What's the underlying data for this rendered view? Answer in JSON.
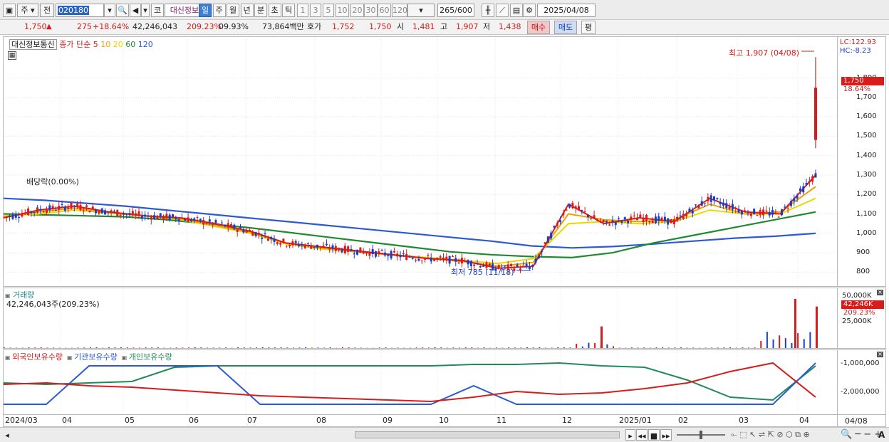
{
  "toolbar": {
    "market": "주",
    "prev": "전",
    "code": "020180",
    "mode": "코",
    "name": "대신정보통",
    "periods": [
      {
        "label": "일",
        "selected": true
      },
      {
        "label": "주"
      },
      {
        "label": "월"
      },
      {
        "label": "년"
      },
      {
        "label": "분"
      },
      {
        "label": "초"
      },
      {
        "label": "틱"
      }
    ],
    "intervals": [
      "1",
      "3",
      "5",
      "10",
      "20",
      "30",
      "60",
      "120"
    ],
    "count": "265",
    "count_total": "/600",
    "date": "2025/04/08"
  },
  "quote": {
    "price": "1,750",
    "change": "275",
    "change_pct": "+18.64%",
    "volume": "42,246,043",
    "vol_ratio": "209.23%",
    "turnover": "09.93%",
    "amount": "73,864백만",
    "hoga_label": "호가",
    "ask": "1,752",
    "bid": "1,750",
    "open_label": "시",
    "open": "1,481",
    "high_label": "고",
    "high": "1,907",
    "low_label": "저",
    "low": "1,438",
    "buy_btn": "매수",
    "sell_btn": "매도",
    "eval_btn": "평"
  },
  "price_panel": {
    "legend_name": "대신정보통신",
    "legend_ma": [
      {
        "label": "종가 단순 5",
        "color": "#d81b1b"
      },
      {
        "label": "10",
        "color": "#f0a000"
      },
      {
        "label": "20",
        "color": "#e8d800"
      },
      {
        "label": "60",
        "color": "#1f8a2f"
      },
      {
        "label": "120",
        "color": "#2c5ad4"
      }
    ],
    "lc": "LC:122.93",
    "hc": "HC:-8.23",
    "y_ticks": [
      "1,800",
      "1,700",
      "1,600",
      "1,500",
      "1,400",
      "1,300",
      "1,200",
      "1,100",
      "1,000",
      "900",
      "800"
    ],
    "current_price_tag": "1,750",
    "current_pct_tag": "18.64%",
    "high_annotation": "최고 1,907 (04/08)",
    "low_annotation": "최저 785 (11/18)",
    "dividend_annotation": "배당락(0.00%)"
  },
  "volume_panel": {
    "title": "거래량",
    "value": "42,246,043주(209.23%)",
    "y_ticks": [
      "50,000K",
      "25,000K"
    ],
    "current_tag": "42,246K",
    "current_pct": "209.23%"
  },
  "holding_panel": {
    "legend": [
      {
        "label": "외국인보유수량",
        "color": "#d81b1b"
      },
      {
        "label": "기관보유수량",
        "color": "#2c5ad4"
      },
      {
        "label": "개인보유수량",
        "color": "#1f8a5a"
      }
    ],
    "y_ticks": [
      "-1,000,000",
      "-2,000,000"
    ]
  },
  "x_axis": [
    "2024/03",
    "04",
    "05",
    "06",
    "07",
    "08",
    "09",
    "10",
    "11",
    "12",
    "2025/01",
    "02",
    "03",
    "04"
  ],
  "x_axis_right": "04/08",
  "colors": {
    "up": "#d81b1b",
    "down": "#1a3fc4",
    "ma5": "#d81b1b",
    "ma10": "#f0a000",
    "ma20": "#e8d800",
    "ma60": "#1f8a2f",
    "ma120": "#2c5ad4"
  },
  "chart_data": {
    "type": "candlestick",
    "x_range": [
      "2024/03",
      "2025/04/08"
    ],
    "ylim": [
      750,
      1950
    ],
    "highlights": {
      "high": 1907,
      "low": 785,
      "last": 1750
    },
    "ma120": [
      1180,
      1170,
      1155,
      1140,
      1120,
      1100,
      1080,
      1060,
      1040,
      1020,
      1000,
      980,
      960,
      935,
      925,
      932,
      945,
      960,
      975,
      985,
      1000
    ],
    "ma60": [
      1100,
      1095,
      1090,
      1085,
      1070,
      1050,
      1030,
      1005,
      980,
      955,
      930,
      905,
      890,
      880,
      875,
      900,
      950,
      990,
      1030,
      1070,
      1110
    ],
    "series": [
      {
        "name": "종가 단순 5",
        "values": [
          1080,
          1120,
          1140,
          1110,
          1090,
          1080,
          1050,
          1010,
          950,
          930,
          910,
          890,
          870,
          860,
          820,
          830,
          1150,
          1050,
          1080,
          1060,
          1180,
          1110,
          1100,
          1300
        ]
      },
      {
        "name": "10",
        "values": [
          1085,
          1110,
          1130,
          1105,
          1090,
          1075,
          1040,
          1005,
          950,
          925,
          905,
          888,
          872,
          855,
          830,
          850,
          1100,
          1070,
          1060,
          1070,
          1150,
          1100,
          1110,
          1240
        ]
      },
      {
        "name": "20",
        "values": [
          1090,
          1100,
          1120,
          1105,
          1090,
          1070,
          1035,
          1000,
          945,
          920,
          905,
          890,
          875,
          860,
          845,
          870,
          1050,
          1060,
          1050,
          1060,
          1120,
          1100,
          1100,
          1180
        ]
      }
    ],
    "volume_peaks_k": [
      {
        "x": "2024/12",
        "value": 22000
      },
      {
        "x": "2025/04",
        "value": 50000
      },
      {
        "x": "2025/04",
        "value": 42246
      }
    ],
    "holdings": {
      "foreign": [
        -1750000,
        -1700000,
        -1800000,
        -1850000,
        -1950000,
        -2050000,
        -2150000,
        -2200000,
        -2250000,
        -2300000,
        -2350000,
        -2200000,
        -2000000,
        -2100000,
        -2050000,
        -1900000,
        -1700000,
        -1300000,
        -1000000,
        -2200000
      ],
      "institution": [
        -2450000,
        -2450000,
        -1100000,
        -1100000,
        -1100000,
        -1100000,
        -2450000,
        -2450000,
        -2450000,
        -2450000,
        -2450000,
        -1800000,
        -2450000,
        -2450000,
        -2450000,
        -2450000,
        -2450000,
        -2450000,
        -2450000,
        -1000000
      ],
      "individual": [
        -1700000,
        -1750000,
        -1700000,
        -1650000,
        -1150000,
        -1100000,
        -1100000,
        -1100000,
        -1100000,
        -1100000,
        -1100000,
        -1050000,
        -1050000,
        -1000000,
        -1100000,
        -1150000,
        -1600000,
        -2200000,
        -2300000,
        -1100000
      ]
    }
  }
}
